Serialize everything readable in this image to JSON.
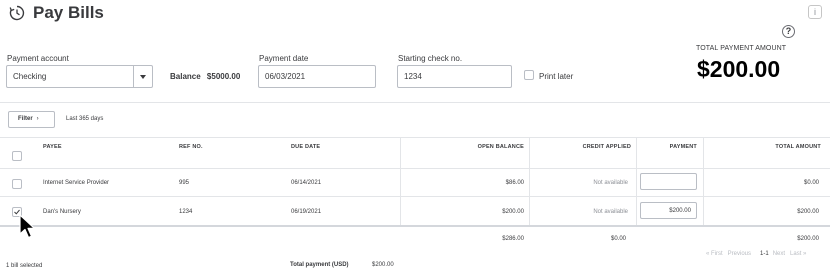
{
  "header": {
    "title": "Pay Bills",
    "close_label": "i",
    "help_label": "?"
  },
  "form": {
    "payment_account_label": "Payment account",
    "payment_account_value": "Checking",
    "balance_label": "Balance",
    "balance_value": "$5000.00",
    "payment_date_label": "Payment date",
    "payment_date_value": "06/03/2021",
    "starting_check_label": "Starting check no.",
    "starting_check_value": "1234",
    "print_later_label": "Print later",
    "print_later_checked": false
  },
  "total": {
    "label": "TOTAL PAYMENT AMOUNT",
    "amount": "$200.00"
  },
  "filter": {
    "button_label": "Filter",
    "chevron": "›",
    "range": "Last 365 days"
  },
  "table": {
    "headers": {
      "payee": "PAYEE",
      "ref_no": "REF NO.",
      "due_date": "DUE DATE",
      "open_balance": "OPEN BALANCE",
      "credit_applied": "CREDIT APPLIED",
      "payment": "PAYMENT",
      "total_amount": "TOTAL AMOUNT"
    },
    "rows": [
      {
        "selected": false,
        "payee": "Internet Service Provider",
        "ref_no": "995",
        "due_date": "06/14/2021",
        "open_balance": "$86.00",
        "credit_applied": "Not available",
        "payment": "",
        "total_amount": "$0.00"
      },
      {
        "selected": true,
        "payee": "Dan's Nursery",
        "ref_no": "1234",
        "due_date": "06/19/2021",
        "open_balance": "$200.00",
        "credit_applied": "Not available",
        "payment": "$200.00",
        "total_amount": "$200.00"
      }
    ],
    "totals": {
      "open_balance": "$286.00",
      "credit_applied": "$0.00",
      "total_amount": "$200.00"
    }
  },
  "pager": {
    "first": "« First",
    "previous": "Previous",
    "current": "1-1",
    "next": "Next",
    "last": "Last »"
  },
  "footer": {
    "selected_count": "1 bill selected",
    "total_payment_label": "Total payment (USD)",
    "total_payment_value": "$200.00"
  },
  "icons": {
    "clock": "clock-icon",
    "help": "help-icon",
    "cursor": "cursor-icon",
    "dropdown": "chevron-down-icon"
  },
  "colors": {
    "text": "#393a3d",
    "border": "#babec5",
    "divider": "#e3e5e8",
    "muted": "#8d9096"
  }
}
